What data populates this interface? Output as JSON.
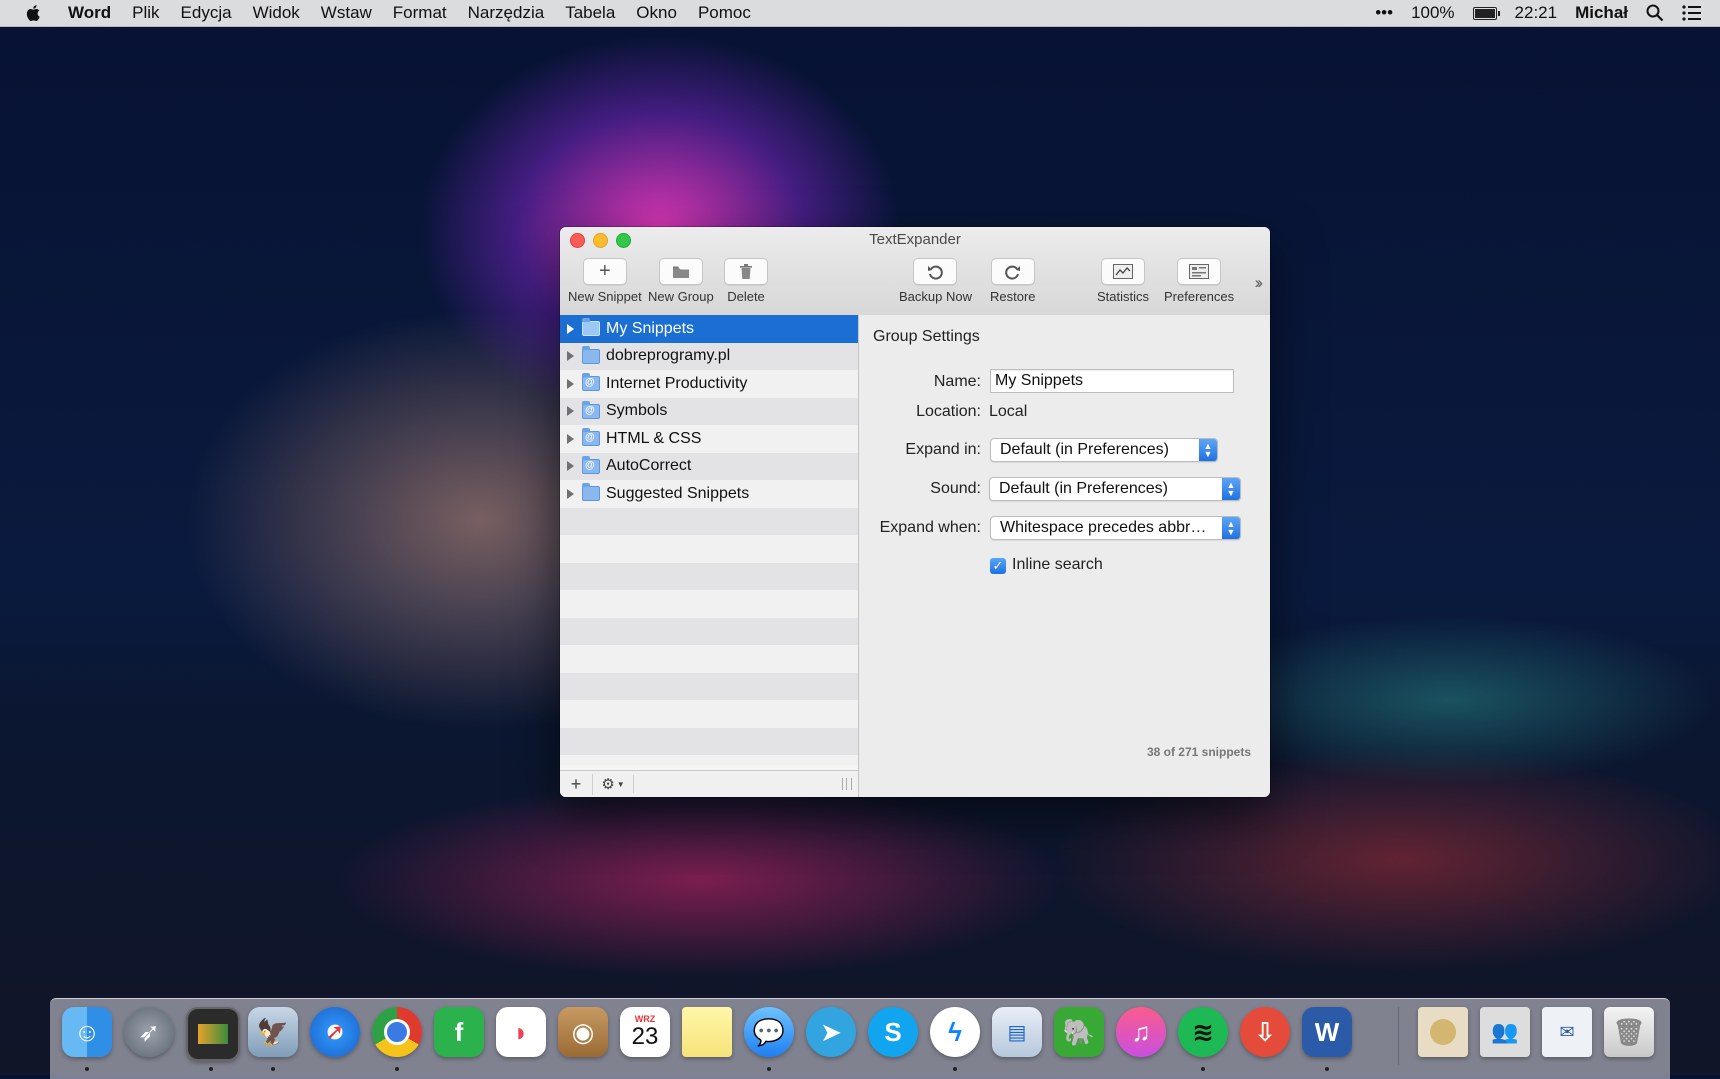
{
  "menubar": {
    "app": "Word",
    "items": [
      "Plik",
      "Edycja",
      "Widok",
      "Wstaw",
      "Format",
      "Narzędzia",
      "Tabela",
      "Okno",
      "Pomoc"
    ],
    "dots": "•••",
    "battery": "100%",
    "time": "22:21",
    "user": "Michał"
  },
  "window": {
    "title": "TextExpander",
    "toolbar": {
      "new_snippet": "New Snippet",
      "new_group": "New Group",
      "delete": "Delete",
      "backup_now": "Backup Now",
      "restore": "Restore",
      "statistics": "Statistics",
      "preferences": "Preferences",
      "overflow": "››"
    },
    "groups": [
      {
        "label": "My Snippets",
        "icon": "folder-icon",
        "selected": true
      },
      {
        "label": "dobreprogramy.pl",
        "icon": "folder-icon"
      },
      {
        "label": "Internet Productivity",
        "icon": "at-folder-icon"
      },
      {
        "label": "Symbols",
        "icon": "at-folder-icon"
      },
      {
        "label": "HTML & CSS",
        "icon": "at-folder-icon"
      },
      {
        "label": "AutoCorrect",
        "icon": "at-folder-icon"
      },
      {
        "label": "Suggested Snippets",
        "icon": "folder-icon"
      }
    ],
    "settings": {
      "heading": "Group Settings",
      "name_label": "Name:",
      "name_value": "My Snippets",
      "location_label": "Location:",
      "location_value": "Local",
      "expand_in_label": "Expand in:",
      "expand_in_value": "Default (in Preferences)",
      "sound_label": "Sound:",
      "sound_value": "Default (in Preferences)",
      "expand_when_label": "Expand when:",
      "expand_when_value": "Whitespace precedes abbr…",
      "inline_search_label": "Inline search",
      "inline_search_checked": true
    },
    "snippet_count": "38 of 271 snippets"
  },
  "dock": {
    "calendar_month": "WRZ",
    "calendar_day": "23",
    "apps": [
      "finder-icon",
      "launchpad-icon",
      "photo-slideshow-icon",
      "preview-icon",
      "safari-icon",
      "chrome-icon",
      "feedly-icon",
      "pocket-icon",
      "contacts-icon",
      "calendar-icon",
      "notes-icon",
      "messages-icon",
      "telegram-icon",
      "skype-icon",
      "messenger-icon",
      "keynote-icon",
      "evernote-icon",
      "itunes-icon",
      "spotify-icon",
      "download-icon",
      "word-icon",
      "folder-icon",
      "people-icon",
      "mail-doc-icon",
      "trash-icon"
    ]
  },
  "colors": {
    "accent": "#1c6fd2",
    "selection": "#1c6fd2"
  }
}
